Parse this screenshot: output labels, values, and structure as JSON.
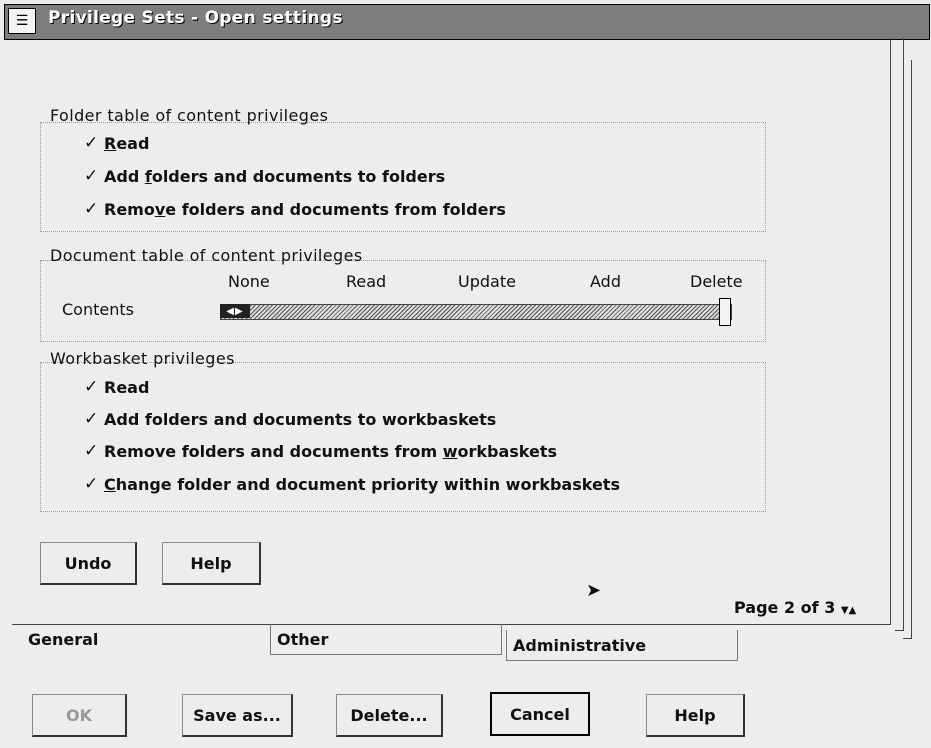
{
  "window": {
    "title": "Privilege Sets - Open settings",
    "system_menu_icon": "system-menu-icon"
  },
  "folder_group": {
    "label": "Folder table of content privileges",
    "items": [
      {
        "label_pre": "",
        "label_u": "R",
        "label_post": "ead",
        "checked": true
      },
      {
        "label_pre": "Add ",
        "label_u": "f",
        "label_post": "olders and documents to folders",
        "checked": true
      },
      {
        "label_pre": "Remo",
        "label_u": "v",
        "label_post": "e folders and documents from folders",
        "checked": true
      }
    ]
  },
  "document_group": {
    "label": "Document table of content privileges",
    "row_label": "Contents",
    "ticks": [
      "None",
      "Read",
      "Update",
      "Add",
      "Delete"
    ],
    "selected_level": "Delete"
  },
  "workbasket_group": {
    "label": "Workbasket privileges",
    "items": [
      {
        "label_pre": "",
        "label_u": "",
        "label_post": "Read",
        "checked": true
      },
      {
        "label_pre": "Add fo",
        "label_u": "",
        "label_post": "lders and documents to workbaskets",
        "checked": true
      },
      {
        "label_pre": "Remove folders and documents from ",
        "label_u": "w",
        "label_post": "orkbaskets",
        "checked": true
      },
      {
        "label_pre": "",
        "label_u": "C",
        "label_post": "hange folder and document priority within workbaskets",
        "checked": true
      }
    ]
  },
  "page_buttons": {
    "undo": "Undo",
    "help": "Help"
  },
  "page_info": "Page 2 of 3",
  "tabs": [
    "General",
    "Other",
    "Administrative"
  ],
  "dialog_buttons": {
    "ok": "OK",
    "save_as": "Save as...",
    "delete": "Delete...",
    "cancel": "Cancel",
    "help": "Help"
  }
}
